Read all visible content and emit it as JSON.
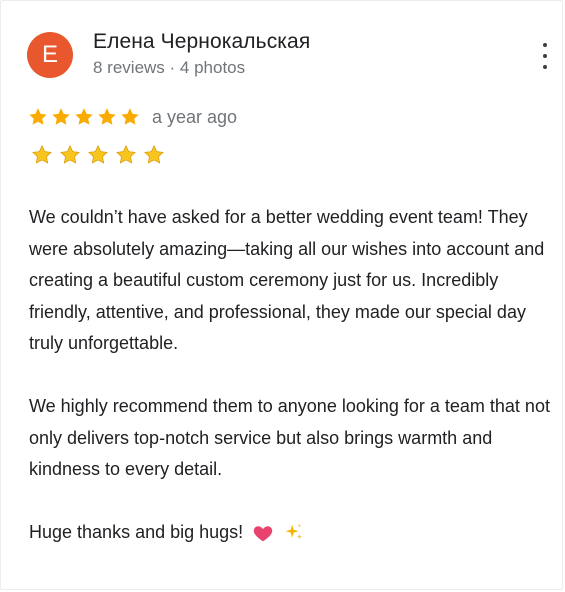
{
  "reviewer": {
    "avatar_letter": "E",
    "name": "Елена Чернокальская",
    "meta": "8 reviews · 4 photos"
  },
  "rating": {
    "stars": 5,
    "time": "a year ago"
  },
  "review": {
    "paragraph1": "We couldn’t have asked for a better wedding event team! They were absolutely amazing—taking all our wishes into account and creating a beautiful custom ceremony just for us. Incredibly friendly, attentive, and professional, they made our special day truly unforgettable.",
    "paragraph2": "We highly recommend them to anyone looking for a team that not only delivers top-notch service but also brings warmth and kindness to every detail.",
    "paragraph3": "Huge thanks and big hugs!"
  },
  "colors": {
    "avatar_bg": "#e8572d",
    "star": "#f9ab00",
    "heart": "#e8436e",
    "sparkle": "#f4b400"
  },
  "icons": [
    "more-vert-icon",
    "star-icon",
    "star-emoji-icon",
    "heart-emoji-icon",
    "sparkles-emoji-icon"
  ]
}
